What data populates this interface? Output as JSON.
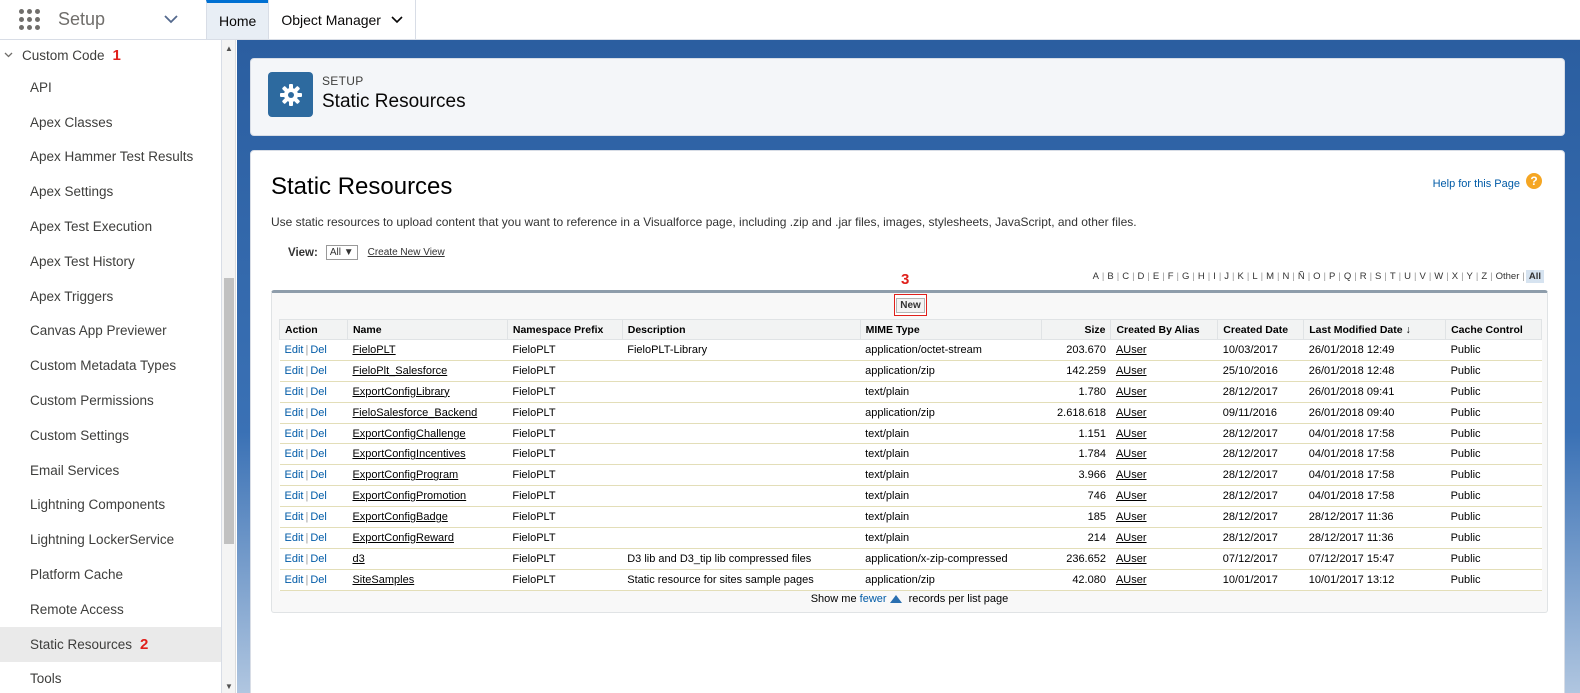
{
  "topbar": {
    "app_name": "Setup",
    "tabs": [
      {
        "label": "Home"
      },
      {
        "label": "Object Manager"
      }
    ]
  },
  "sidebar": {
    "section_label": "Custom Code",
    "section_marker": "1",
    "items": [
      {
        "label": "API"
      },
      {
        "label": "Apex Classes"
      },
      {
        "label": "Apex Hammer Test Results"
      },
      {
        "label": "Apex Settings"
      },
      {
        "label": "Apex Test Execution"
      },
      {
        "label": "Apex Test History"
      },
      {
        "label": "Apex Triggers"
      },
      {
        "label": "Canvas App Previewer"
      },
      {
        "label": "Custom Metadata Types"
      },
      {
        "label": "Custom Permissions"
      },
      {
        "label": "Custom Settings"
      },
      {
        "label": "Email Services"
      },
      {
        "label": "Lightning Components"
      },
      {
        "label": "Lightning LockerService"
      },
      {
        "label": "Platform Cache"
      },
      {
        "label": "Remote Access"
      },
      {
        "label": "Static Resources"
      },
      {
        "label": "Tools"
      }
    ],
    "active_marker": "2"
  },
  "header": {
    "eyebrow": "SETUP",
    "title": "Static Resources"
  },
  "content": {
    "title": "Static Resources",
    "help_label": "Help for this Page",
    "help_icon": "?",
    "description": "Use static resources to upload content that you want to reference in a Visualforce page, including .zip and .jar files, images, stylesheets, JavaScript, and other files.",
    "view_label": "View:",
    "view_value": "All ▼",
    "create_view_label": "Create New View",
    "new_marker": "3",
    "new_label": "New",
    "pager_prefix": "Show me",
    "pager_link": "fewer",
    "pager_suffix": "records per list page"
  },
  "alpha": {
    "letters": [
      "A",
      "B",
      "C",
      "D",
      "E",
      "F",
      "G",
      "H",
      "I",
      "J",
      "K",
      "L",
      "M",
      "N",
      "Ñ",
      "O",
      "P",
      "Q",
      "R",
      "S",
      "T",
      "U",
      "V",
      "W",
      "X",
      "Y",
      "Z",
      "Other"
    ],
    "all_label": "All"
  },
  "table": {
    "columns": [
      "Action",
      "Name",
      "Namespace Prefix",
      "Description",
      "MIME Type",
      "Size",
      "Created By Alias",
      "Created Date",
      "Last Modified Date ↓",
      "Cache Control"
    ],
    "edit_label": "Edit",
    "del_label": "Del",
    "rows": [
      {
        "name": "FieloPLT",
        "ns": "FieloPLT",
        "desc": "FieloPLT-Library",
        "mime": "application/octet-stream",
        "size": "203.670",
        "alias": "AUser",
        "created": "10/03/2017",
        "modified": "26/01/2018 12:49",
        "cache": "Public"
      },
      {
        "name": "FieloPlt_Salesforce",
        "ns": "FieloPLT",
        "desc": "",
        "mime": "application/zip",
        "size": "142.259",
        "alias": "AUser",
        "created": "25/10/2016",
        "modified": "26/01/2018 12:48",
        "cache": "Public"
      },
      {
        "name": "ExportConfigLibrary",
        "ns": "FieloPLT",
        "desc": "",
        "mime": "text/plain",
        "size": "1.780",
        "alias": "AUser",
        "created": "28/12/2017",
        "modified": "26/01/2018 09:41",
        "cache": "Public"
      },
      {
        "name": "FieloSalesforce_Backend",
        "ns": "FieloPLT",
        "desc": "",
        "mime": "application/zip",
        "size": "2.618.618",
        "alias": "AUser",
        "created": "09/11/2016",
        "modified": "26/01/2018 09:40",
        "cache": "Public"
      },
      {
        "name": "ExportConfigChallenge",
        "ns": "FieloPLT",
        "desc": "",
        "mime": "text/plain",
        "size": "1.151",
        "alias": "AUser",
        "created": "28/12/2017",
        "modified": "04/01/2018 17:58",
        "cache": "Public"
      },
      {
        "name": "ExportConfigIncentives",
        "ns": "FieloPLT",
        "desc": "",
        "mime": "text/plain",
        "size": "1.784",
        "alias": "AUser",
        "created": "28/12/2017",
        "modified": "04/01/2018 17:58",
        "cache": "Public"
      },
      {
        "name": "ExportConfigProgram",
        "ns": "FieloPLT",
        "desc": "",
        "mime": "text/plain",
        "size": "3.966",
        "alias": "AUser",
        "created": "28/12/2017",
        "modified": "04/01/2018 17:58",
        "cache": "Public"
      },
      {
        "name": "ExportConfigPromotion",
        "ns": "FieloPLT",
        "desc": "",
        "mime": "text/plain",
        "size": "746",
        "alias": "AUser",
        "created": "28/12/2017",
        "modified": "04/01/2018 17:58",
        "cache": "Public"
      },
      {
        "name": "ExportConfigBadge",
        "ns": "FieloPLT",
        "desc": "",
        "mime": "text/plain",
        "size": "185",
        "alias": "AUser",
        "created": "28/12/2017",
        "modified": "28/12/2017 11:36",
        "cache": "Public"
      },
      {
        "name": "ExportConfigReward",
        "ns": "FieloPLT",
        "desc": "",
        "mime": "text/plain",
        "size": "214",
        "alias": "AUser",
        "created": "28/12/2017",
        "modified": "28/12/2017 11:36",
        "cache": "Public"
      },
      {
        "name": "d3",
        "ns": "FieloPLT",
        "desc": "D3 lib and D3_tip lib compressed files",
        "mime": "application/x-zip-compressed",
        "size": "236.652",
        "alias": "AUser",
        "created": "07/12/2017",
        "modified": "07/12/2017 15:47",
        "cache": "Public"
      },
      {
        "name": "SiteSamples",
        "ns": "FieloPLT",
        "desc": "Static resource for sites sample pages",
        "mime": "application/zip",
        "size": "42.080",
        "alias": "AUser",
        "created": "10/01/2017",
        "modified": "10/01/2017 13:12",
        "cache": "Public"
      }
    ]
  },
  "colors": {
    "accent": "#0070d2",
    "marker_red": "#e0201b",
    "header_icon_bg": "#2d6a9f",
    "link_blue": "#015ba7"
  }
}
